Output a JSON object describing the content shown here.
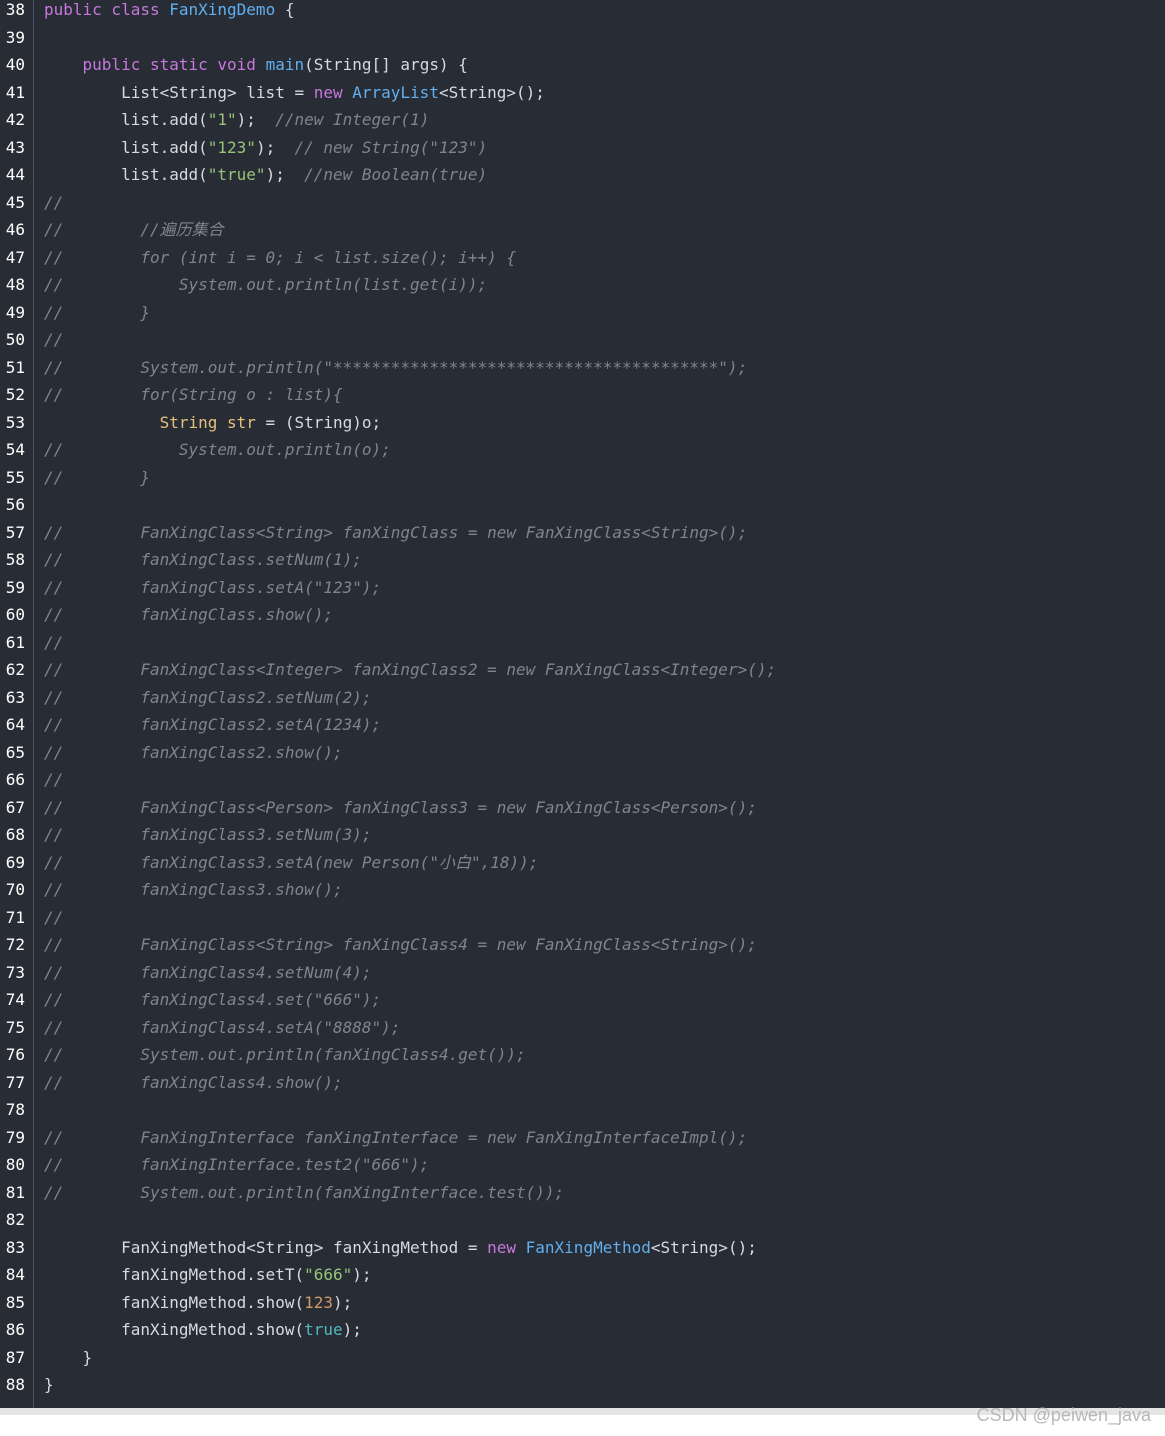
{
  "colors": {
    "background": "#282c34",
    "keyword": "#c678dd",
    "class_name": "#61afef",
    "string": "#98c379",
    "number": "#d19a66",
    "comment": "#7f848e",
    "text": "#d7dae0"
  },
  "watermark": "CSDN @peiwen_java",
  "lines": [
    {
      "n": "38",
      "tokens": [
        {
          "t": "public class ",
          "k": "kw"
        },
        {
          "t": "FanXingDemo",
          "k": "cls"
        },
        {
          "t": " {",
          "k": ""
        }
      ]
    },
    {
      "n": "39",
      "tokens": []
    },
    {
      "n": "40",
      "tokens": [
        {
          "t": "    ",
          "k": ""
        },
        {
          "t": "public static void ",
          "k": "kw"
        },
        {
          "t": "main",
          "k": "fn"
        },
        {
          "t": "(String[] args) {",
          "k": ""
        }
      ]
    },
    {
      "n": "41",
      "tokens": [
        {
          "t": "        List<String> list = ",
          "k": ""
        },
        {
          "t": "new ",
          "k": "kw"
        },
        {
          "t": "ArrayList",
          "k": "cls"
        },
        {
          "t": "<String>();",
          "k": ""
        }
      ]
    },
    {
      "n": "42",
      "tokens": [
        {
          "t": "        list.add(",
          "k": ""
        },
        {
          "t": "\"1\"",
          "k": "str"
        },
        {
          "t": ");  ",
          "k": ""
        },
        {
          "t": "//new Integer(1)",
          "k": "cmt"
        }
      ]
    },
    {
      "n": "43",
      "tokens": [
        {
          "t": "        list.add(",
          "k": ""
        },
        {
          "t": "\"123\"",
          "k": "str"
        },
        {
          "t": ");  ",
          "k": ""
        },
        {
          "t": "// new String(\"123\")",
          "k": "cmt"
        }
      ]
    },
    {
      "n": "44",
      "tokens": [
        {
          "t": "        list.add(",
          "k": ""
        },
        {
          "t": "\"true\"",
          "k": "str"
        },
        {
          "t": ");  ",
          "k": ""
        },
        {
          "t": "//new Boolean(true)",
          "k": "cmt"
        }
      ]
    },
    {
      "n": "45",
      "tokens": [
        {
          "t": "//",
          "k": "cmt"
        }
      ]
    },
    {
      "n": "46",
      "tokens": [
        {
          "t": "//        //遍历集合",
          "k": "cmt"
        }
      ]
    },
    {
      "n": "47",
      "tokens": [
        {
          "t": "//        for (int i = 0; i < list.size(); i++) {",
          "k": "cmt"
        }
      ]
    },
    {
      "n": "48",
      "tokens": [
        {
          "t": "//            System.out.println(list.get(i));",
          "k": "cmt"
        }
      ]
    },
    {
      "n": "49",
      "tokens": [
        {
          "t": "//        }",
          "k": "cmt"
        }
      ]
    },
    {
      "n": "50",
      "tokens": [
        {
          "t": "//",
          "k": "cmt"
        }
      ]
    },
    {
      "n": "51",
      "tokens": [
        {
          "t": "//        System.out.println(\"****************************************\");",
          "k": "cmt"
        }
      ]
    },
    {
      "n": "52",
      "tokens": [
        {
          "t": "//        for(String o : list){",
          "k": "cmt"
        }
      ]
    },
    {
      "n": "53",
      "tokens": [
        {
          "t": "            ",
          "k": ""
        },
        {
          "t": "String str",
          "k": "var"
        },
        {
          "t": " = (String)o;",
          "k": ""
        }
      ]
    },
    {
      "n": "54",
      "tokens": [
        {
          "t": "//            System.out.println(o);",
          "k": "cmt"
        }
      ]
    },
    {
      "n": "55",
      "tokens": [
        {
          "t": "//        }",
          "k": "cmt"
        }
      ]
    },
    {
      "n": "56",
      "tokens": []
    },
    {
      "n": "57",
      "tokens": [
        {
          "t": "//        FanXingClass<String> fanXingClass = new FanXingClass<String>();",
          "k": "cmt"
        }
      ]
    },
    {
      "n": "58",
      "tokens": [
        {
          "t": "//        fanXingClass.setNum(1);",
          "k": "cmt"
        }
      ]
    },
    {
      "n": "59",
      "tokens": [
        {
          "t": "//        fanXingClass.setA(\"123\");",
          "k": "cmt"
        }
      ]
    },
    {
      "n": "60",
      "tokens": [
        {
          "t": "//        fanXingClass.show();",
          "k": "cmt"
        }
      ]
    },
    {
      "n": "61",
      "tokens": [
        {
          "t": "//",
          "k": "cmt"
        }
      ]
    },
    {
      "n": "62",
      "tokens": [
        {
          "t": "//        FanXingClass<Integer> fanXingClass2 = new FanXingClass<Integer>();",
          "k": "cmt"
        }
      ]
    },
    {
      "n": "63",
      "tokens": [
        {
          "t": "//        fanXingClass2.setNum(2);",
          "k": "cmt"
        }
      ]
    },
    {
      "n": "64",
      "tokens": [
        {
          "t": "//        fanXingClass2.setA(1234);",
          "k": "cmt"
        }
      ]
    },
    {
      "n": "65",
      "tokens": [
        {
          "t": "//        fanXingClass2.show();",
          "k": "cmt"
        }
      ]
    },
    {
      "n": "66",
      "tokens": [
        {
          "t": "//",
          "k": "cmt"
        }
      ]
    },
    {
      "n": "67",
      "tokens": [
        {
          "t": "//        FanXingClass<Person> fanXingClass3 = new FanXingClass<Person>();",
          "k": "cmt"
        }
      ]
    },
    {
      "n": "68",
      "tokens": [
        {
          "t": "//        fanXingClass3.setNum(3);",
          "k": "cmt"
        }
      ]
    },
    {
      "n": "69",
      "tokens": [
        {
          "t": "//        fanXingClass3.setA(new Person(\"小白\",18));",
          "k": "cmt"
        }
      ]
    },
    {
      "n": "70",
      "tokens": [
        {
          "t": "//        fanXingClass3.show();",
          "k": "cmt"
        }
      ]
    },
    {
      "n": "71",
      "tokens": [
        {
          "t": "//",
          "k": "cmt"
        }
      ]
    },
    {
      "n": "72",
      "tokens": [
        {
          "t": "//        FanXingClass<String> fanXingClass4 = new FanXingClass<String>();",
          "k": "cmt"
        }
      ]
    },
    {
      "n": "73",
      "tokens": [
        {
          "t": "//        fanXingClass4.setNum(4);",
          "k": "cmt"
        }
      ]
    },
    {
      "n": "74",
      "tokens": [
        {
          "t": "//        fanXingClass4.set(\"666\");",
          "k": "cmt"
        }
      ]
    },
    {
      "n": "75",
      "tokens": [
        {
          "t": "//        fanXingClass4.setA(\"8888\");",
          "k": "cmt"
        }
      ]
    },
    {
      "n": "76",
      "tokens": [
        {
          "t": "//        System.out.println(fanXingClass4.get());",
          "k": "cmt"
        }
      ]
    },
    {
      "n": "77",
      "tokens": [
        {
          "t": "//        fanXingClass4.show();",
          "k": "cmt"
        }
      ]
    },
    {
      "n": "78",
      "tokens": []
    },
    {
      "n": "79",
      "tokens": [
        {
          "t": "//        FanXingInterface fanXingInterface = new FanXingInterfaceImpl();",
          "k": "cmt"
        }
      ]
    },
    {
      "n": "80",
      "tokens": [
        {
          "t": "//        fanXingInterface.test2(\"666\");",
          "k": "cmt"
        }
      ]
    },
    {
      "n": "81",
      "tokens": [
        {
          "t": "//        System.out.println(fanXingInterface.test());",
          "k": "cmt"
        }
      ]
    },
    {
      "n": "82",
      "tokens": []
    },
    {
      "n": "83",
      "tokens": [
        {
          "t": "        FanXingMethod<String> fanXingMethod = ",
          "k": ""
        },
        {
          "t": "new ",
          "k": "kw"
        },
        {
          "t": "FanXingMethod",
          "k": "cls"
        },
        {
          "t": "<String>();",
          "k": ""
        }
      ]
    },
    {
      "n": "84",
      "tokens": [
        {
          "t": "        fanXingMethod.setT(",
          "k": ""
        },
        {
          "t": "\"666\"",
          "k": "str"
        },
        {
          "t": ");",
          "k": ""
        }
      ]
    },
    {
      "n": "85",
      "tokens": [
        {
          "t": "        fanXingMethod.show(",
          "k": ""
        },
        {
          "t": "123",
          "k": "num"
        },
        {
          "t": ");",
          "k": ""
        }
      ]
    },
    {
      "n": "86",
      "tokens": [
        {
          "t": "        fanXingMethod.show(",
          "k": ""
        },
        {
          "t": "true",
          "k": "bool"
        },
        {
          "t": ");",
          "k": ""
        }
      ]
    },
    {
      "n": "87",
      "tokens": [
        {
          "t": "    }",
          "k": ""
        }
      ]
    },
    {
      "n": "88",
      "tokens": [
        {
          "t": "}",
          "k": ""
        }
      ]
    }
  ]
}
